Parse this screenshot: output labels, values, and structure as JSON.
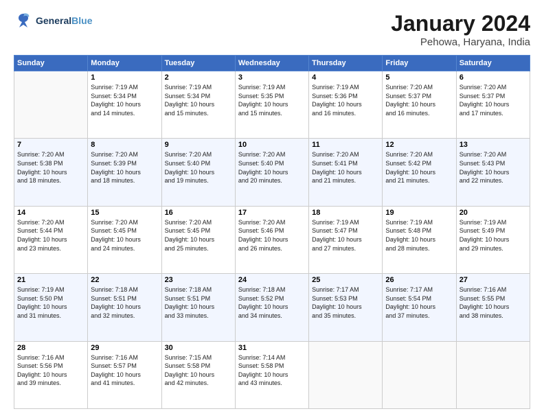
{
  "logo": {
    "line1": "General",
    "line2": "Blue"
  },
  "title": "January 2024",
  "subtitle": "Pehowa, Haryana, India",
  "columns": [
    "Sunday",
    "Monday",
    "Tuesday",
    "Wednesday",
    "Thursday",
    "Friday",
    "Saturday"
  ],
  "weeks": [
    [
      {
        "day": "",
        "info": ""
      },
      {
        "day": "1",
        "info": "Sunrise: 7:19 AM\nSunset: 5:34 PM\nDaylight: 10 hours\nand 14 minutes."
      },
      {
        "day": "2",
        "info": "Sunrise: 7:19 AM\nSunset: 5:34 PM\nDaylight: 10 hours\nand 15 minutes."
      },
      {
        "day": "3",
        "info": "Sunrise: 7:19 AM\nSunset: 5:35 PM\nDaylight: 10 hours\nand 15 minutes."
      },
      {
        "day": "4",
        "info": "Sunrise: 7:19 AM\nSunset: 5:36 PM\nDaylight: 10 hours\nand 16 minutes."
      },
      {
        "day": "5",
        "info": "Sunrise: 7:20 AM\nSunset: 5:37 PM\nDaylight: 10 hours\nand 16 minutes."
      },
      {
        "day": "6",
        "info": "Sunrise: 7:20 AM\nSunset: 5:37 PM\nDaylight: 10 hours\nand 17 minutes."
      }
    ],
    [
      {
        "day": "7",
        "info": "Sunrise: 7:20 AM\nSunset: 5:38 PM\nDaylight: 10 hours\nand 18 minutes."
      },
      {
        "day": "8",
        "info": "Sunrise: 7:20 AM\nSunset: 5:39 PM\nDaylight: 10 hours\nand 18 minutes."
      },
      {
        "day": "9",
        "info": "Sunrise: 7:20 AM\nSunset: 5:40 PM\nDaylight: 10 hours\nand 19 minutes."
      },
      {
        "day": "10",
        "info": "Sunrise: 7:20 AM\nSunset: 5:40 PM\nDaylight: 10 hours\nand 20 minutes."
      },
      {
        "day": "11",
        "info": "Sunrise: 7:20 AM\nSunset: 5:41 PM\nDaylight: 10 hours\nand 21 minutes."
      },
      {
        "day": "12",
        "info": "Sunrise: 7:20 AM\nSunset: 5:42 PM\nDaylight: 10 hours\nand 21 minutes."
      },
      {
        "day": "13",
        "info": "Sunrise: 7:20 AM\nSunset: 5:43 PM\nDaylight: 10 hours\nand 22 minutes."
      }
    ],
    [
      {
        "day": "14",
        "info": "Sunrise: 7:20 AM\nSunset: 5:44 PM\nDaylight: 10 hours\nand 23 minutes."
      },
      {
        "day": "15",
        "info": "Sunrise: 7:20 AM\nSunset: 5:45 PM\nDaylight: 10 hours\nand 24 minutes."
      },
      {
        "day": "16",
        "info": "Sunrise: 7:20 AM\nSunset: 5:45 PM\nDaylight: 10 hours\nand 25 minutes."
      },
      {
        "day": "17",
        "info": "Sunrise: 7:20 AM\nSunset: 5:46 PM\nDaylight: 10 hours\nand 26 minutes."
      },
      {
        "day": "18",
        "info": "Sunrise: 7:19 AM\nSunset: 5:47 PM\nDaylight: 10 hours\nand 27 minutes."
      },
      {
        "day": "19",
        "info": "Sunrise: 7:19 AM\nSunset: 5:48 PM\nDaylight: 10 hours\nand 28 minutes."
      },
      {
        "day": "20",
        "info": "Sunrise: 7:19 AM\nSunset: 5:49 PM\nDaylight: 10 hours\nand 29 minutes."
      }
    ],
    [
      {
        "day": "21",
        "info": "Sunrise: 7:19 AM\nSunset: 5:50 PM\nDaylight: 10 hours\nand 31 minutes."
      },
      {
        "day": "22",
        "info": "Sunrise: 7:18 AM\nSunset: 5:51 PM\nDaylight: 10 hours\nand 32 minutes."
      },
      {
        "day": "23",
        "info": "Sunrise: 7:18 AM\nSunset: 5:51 PM\nDaylight: 10 hours\nand 33 minutes."
      },
      {
        "day": "24",
        "info": "Sunrise: 7:18 AM\nSunset: 5:52 PM\nDaylight: 10 hours\nand 34 minutes."
      },
      {
        "day": "25",
        "info": "Sunrise: 7:17 AM\nSunset: 5:53 PM\nDaylight: 10 hours\nand 35 minutes."
      },
      {
        "day": "26",
        "info": "Sunrise: 7:17 AM\nSunset: 5:54 PM\nDaylight: 10 hours\nand 37 minutes."
      },
      {
        "day": "27",
        "info": "Sunrise: 7:16 AM\nSunset: 5:55 PM\nDaylight: 10 hours\nand 38 minutes."
      }
    ],
    [
      {
        "day": "28",
        "info": "Sunrise: 7:16 AM\nSunset: 5:56 PM\nDaylight: 10 hours\nand 39 minutes."
      },
      {
        "day": "29",
        "info": "Sunrise: 7:16 AM\nSunset: 5:57 PM\nDaylight: 10 hours\nand 41 minutes."
      },
      {
        "day": "30",
        "info": "Sunrise: 7:15 AM\nSunset: 5:58 PM\nDaylight: 10 hours\nand 42 minutes."
      },
      {
        "day": "31",
        "info": "Sunrise: 7:14 AM\nSunset: 5:58 PM\nDaylight: 10 hours\nand 43 minutes."
      },
      {
        "day": "",
        "info": ""
      },
      {
        "day": "",
        "info": ""
      },
      {
        "day": "",
        "info": ""
      }
    ]
  ]
}
